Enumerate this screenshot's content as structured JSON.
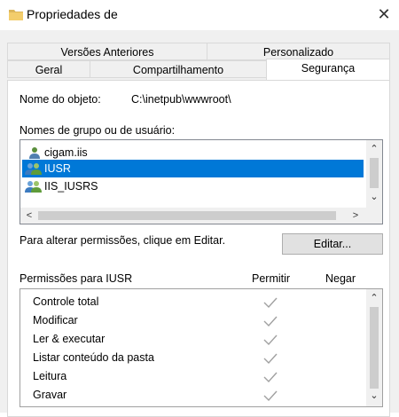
{
  "window": {
    "title": "Propriedades de",
    "close_glyph": "✕",
    "folder_icon": "folder-icon"
  },
  "tabs": {
    "row1": [
      {
        "label": "Versões Anteriores"
      },
      {
        "label": "Personalizado"
      }
    ],
    "row2": [
      {
        "label": "Geral"
      },
      {
        "label": "Compartilhamento"
      },
      {
        "label": "Segurança",
        "active": true
      }
    ]
  },
  "object": {
    "label": "Nome do objeto:",
    "value": "C:\\inetpub\\wwwroot\\"
  },
  "groups": {
    "label": "Nomes de grupo ou de usuário:",
    "items": [
      {
        "name": "cigam.iis",
        "icon": "user-icon",
        "selected": false
      },
      {
        "name": "IUSR",
        "icon": "group-icon",
        "selected": true
      },
      {
        "name": "IIS_IUSRS",
        "icon": "group-icon",
        "selected": false
      }
    ],
    "scroll_up": "⌃",
    "scroll_down": "⌄",
    "scroll_left": "<",
    "scroll_right": ">"
  },
  "edit": {
    "hint": "Para alterar permissões, clique em Editar.",
    "button_label": "Editar..."
  },
  "permissions": {
    "label": "Permissões para IUSR",
    "allow_header": "Permitir",
    "deny_header": "Negar",
    "items": [
      {
        "name": "Controle total",
        "allow": true,
        "deny": false
      },
      {
        "name": "Modificar",
        "allow": true,
        "deny": false
      },
      {
        "name": "Ler & executar",
        "allow": true,
        "deny": false
      },
      {
        "name": "Listar conteúdo da pasta",
        "allow": true,
        "deny": false
      },
      {
        "name": "Leitura",
        "allow": true,
        "deny": false
      },
      {
        "name": "Gravar",
        "allow": true,
        "deny": false
      }
    ],
    "check_color": "#a0a0a0"
  },
  "colors": {
    "selection": "#0078d7",
    "folder": "#dcb65a"
  }
}
